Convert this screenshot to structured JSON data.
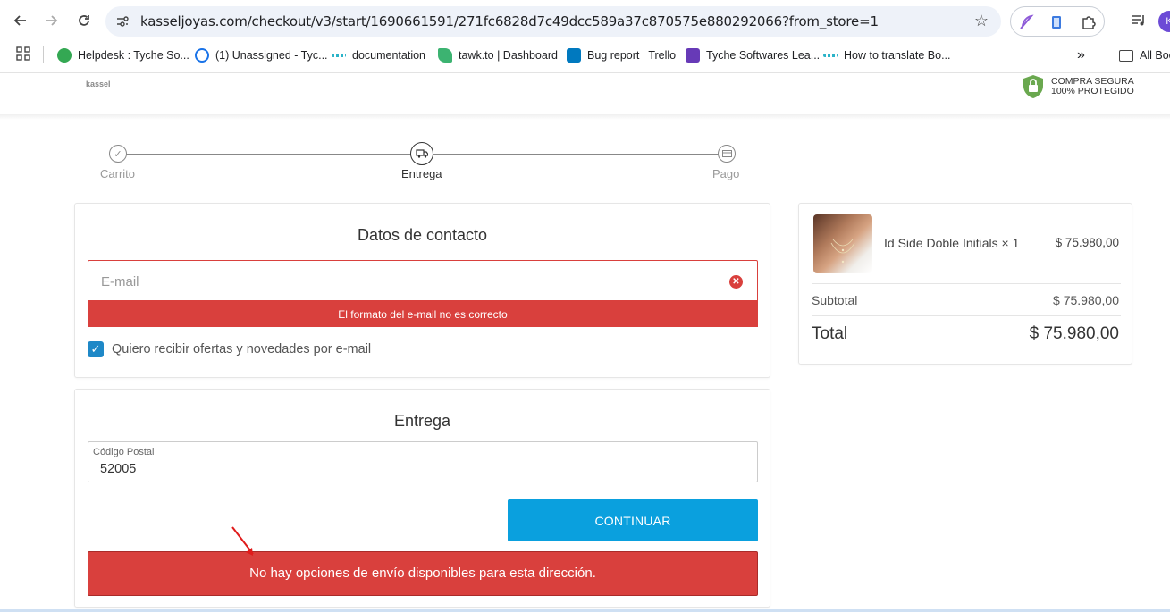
{
  "browser": {
    "url": "kasseljoyas.com/checkout/v3/start/1690661591/271fc6828d7c49dcc589a37c870575e880292066?from_store=1",
    "profile_initial": "K",
    "bookmarks": [
      {
        "label": "Helpdesk : Tyche So...",
        "icon": "helpdesk-icon",
        "color": "#34a853"
      },
      {
        "label": "(1) Unassigned - Tyc...",
        "icon": "support-icon",
        "color": "#1a73e8"
      },
      {
        "label": "documentation",
        "icon": "dots-icon",
        "color": "#2bb3c8"
      },
      {
        "label": "tawk.to | Dashboard",
        "icon": "tawk-icon",
        "color": "#3cb371"
      },
      {
        "label": "Bug report | Trello",
        "icon": "trello-icon",
        "color": "#0079bf"
      },
      {
        "label": "Tyche Softwares Lea...",
        "icon": "forms-icon",
        "color": "#673ab7"
      },
      {
        "label": "How to translate Bo...",
        "icon": "dots-icon",
        "color": "#2bb3c8"
      }
    ],
    "more_label": "»",
    "all_bookmarks": "All Boo"
  },
  "header": {
    "logo": "kassel",
    "secure_line1": "COMPRA SEGURA",
    "secure_line2": "100% PROTEGIDO",
    "brand_green": "#6aa84f"
  },
  "steps": [
    {
      "label": "Carrito",
      "state": "done"
    },
    {
      "label": "Entrega",
      "state": "active"
    },
    {
      "label": "Pago",
      "state": "pending"
    }
  ],
  "contact": {
    "title": "Datos de contacto",
    "email_placeholder": "E-mail",
    "email_value": "",
    "email_error": "El formato del e-mail no es correcto",
    "newsletter_checked": true,
    "newsletter_label": "Quiero recibir ofertas y novedades por e-mail"
  },
  "delivery": {
    "title": "Entrega",
    "zip_label": "Código Postal",
    "zip_value": "52005",
    "continue_label": "CONTINUAR",
    "shipping_error": "No hay opciones de envío disponibles para esta dirección."
  },
  "summary": {
    "product_name": "Id Side Doble Initials × 1",
    "product_price": "$ 75.980,00",
    "subtotal_label": "Subtotal",
    "subtotal_value": "$ 75.980,00",
    "total_label": "Total",
    "total_value": "$ 75.980,00"
  },
  "colors": {
    "error_red": "#d9403d",
    "primary_blue": "#0aa0de",
    "checkbox_blue": "#1e88c7"
  }
}
